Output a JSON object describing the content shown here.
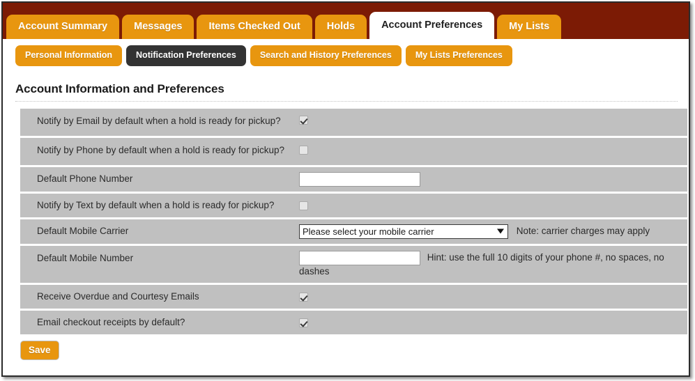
{
  "colors": {
    "header_bar": "#7c1b05",
    "tab_orange": "#e8960f",
    "active_subtab": "#333333",
    "row_gray": "#c0c0c0",
    "text_dark": "#2a2a2a"
  },
  "primary_tabs": [
    {
      "label": "Account Summary",
      "active": false
    },
    {
      "label": "Messages",
      "active": false
    },
    {
      "label": "Items Checked Out",
      "active": false
    },
    {
      "label": "Holds",
      "active": false
    },
    {
      "label": "Account Preferences",
      "active": true
    },
    {
      "label": "My Lists",
      "active": false
    }
  ],
  "sub_tabs": [
    {
      "label": "Personal Information",
      "active": false
    },
    {
      "label": "Notification Preferences",
      "active": true
    },
    {
      "label": "Search and History Preferences",
      "active": false
    },
    {
      "label": "My Lists Preferences",
      "active": false
    }
  ],
  "page_title": "Account Information and Preferences",
  "rows": [
    {
      "label": "Notify by Email by default when a hold is ready for pickup?",
      "type": "checkbox",
      "checked": true
    },
    {
      "label": "Notify by Phone by default when a hold is ready for pickup?",
      "type": "checkbox",
      "checked": false
    },
    {
      "label": "Default Phone Number",
      "type": "text",
      "value": "",
      "placeholder": ""
    },
    {
      "label": "Notify by Text by default when a hold is ready for pickup?",
      "type": "checkbox",
      "checked": false
    },
    {
      "label": "Default Mobile Carrier",
      "type": "select",
      "selected": "Please select your mobile carrier",
      "note": "Note: carrier charges may apply"
    },
    {
      "label": "Default Mobile Number",
      "type": "text",
      "value": "",
      "placeholder": "",
      "hint": "Hint: use the full 10 digits of your phone #, no spaces, no dashes"
    },
    {
      "label": "Receive Overdue and Courtesy Emails",
      "type": "checkbox",
      "checked": true
    },
    {
      "label": "Email checkout receipts by default?",
      "type": "checkbox",
      "checked": true
    }
  ],
  "save_label": "Save"
}
